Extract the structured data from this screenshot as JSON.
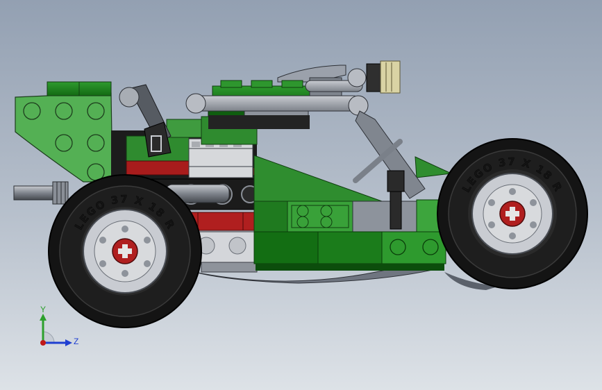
{
  "viewport": {
    "background_top": "#93a0b2",
    "background_bottom": "#dde2e7"
  },
  "model": {
    "tire_text_front": "LEGO 37 X 18 R",
    "tire_text_rear": "LEGO 37 X 18 R",
    "colors": {
      "green": "#1e7d1e",
      "light_green": "#4fb64f",
      "dark_green": "#0e5a0e",
      "light_gray": "#d3d5d8",
      "mid_gray": "#8f949c",
      "dark_gray": "#4b4f56",
      "black": "#1b1b1b",
      "red": "#b01f1f",
      "tan": "#d9d3a4"
    }
  },
  "triad": {
    "y_label": "Y",
    "z_label": "Z",
    "y_color": "#2ca02c",
    "z_color": "#1f3fd1",
    "origin_color": "#c01818"
  }
}
